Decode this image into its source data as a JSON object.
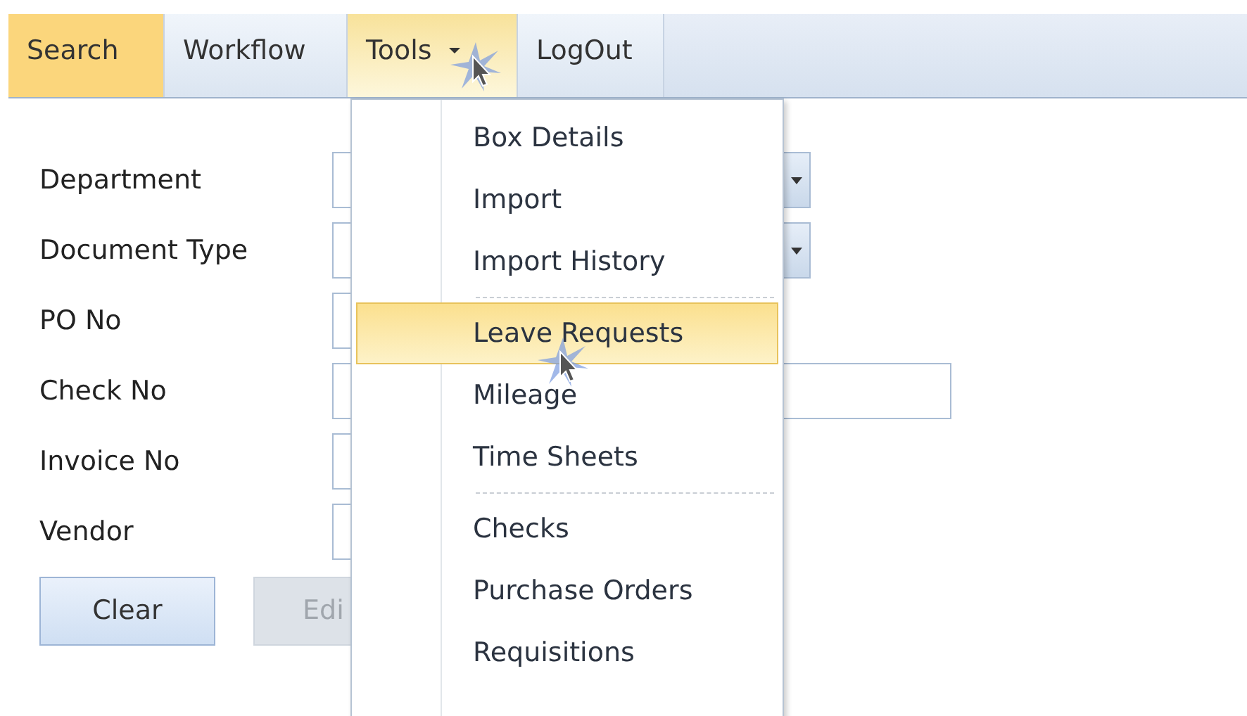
{
  "menubar": {
    "tabs": [
      {
        "label": "Search",
        "selected": true,
        "open": false
      },
      {
        "label": "Workflow",
        "selected": false,
        "open": false
      },
      {
        "label": "Tools",
        "selected": false,
        "open": true
      },
      {
        "label": "LogOut",
        "selected": false,
        "open": false
      }
    ]
  },
  "form": {
    "fields": [
      {
        "label": "Department",
        "kind": "dropdown"
      },
      {
        "label": "Document Type",
        "kind": "dropdown"
      },
      {
        "label": "PO No",
        "kind": "text"
      },
      {
        "label": "Check No",
        "kind": "wide_text"
      },
      {
        "label": "Invoice No",
        "kind": "text"
      },
      {
        "label": "Vendor",
        "kind": "text"
      }
    ],
    "buttons": [
      {
        "label": "Clear",
        "disabled": false
      },
      {
        "label": "Edi",
        "disabled": true
      }
    ]
  },
  "tools_menu": {
    "groups": [
      [
        {
          "label": "Box Details",
          "selected": false
        },
        {
          "label": "Import",
          "selected": false
        },
        {
          "label": "Import History",
          "selected": false
        }
      ],
      [
        {
          "label": "Leave Requests",
          "selected": true
        },
        {
          "label": "Mileage",
          "selected": false
        },
        {
          "label": "Time Sheets",
          "selected": false
        }
      ],
      [
        {
          "label": "Checks",
          "selected": false
        },
        {
          "label": "Purchase Orders",
          "selected": false
        },
        {
          "label": "Requisitions",
          "selected": false
        }
      ]
    ]
  }
}
